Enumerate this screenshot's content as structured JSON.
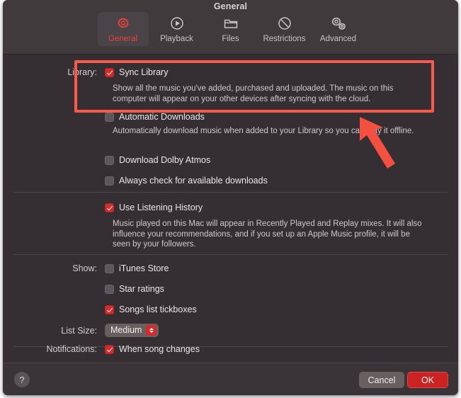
{
  "window": {
    "title": "General"
  },
  "toolbar": {
    "tabs": [
      {
        "label": "General",
        "icon": "gear-icon",
        "selected": true
      },
      {
        "label": "Playback",
        "icon": "play-circle-icon",
        "selected": false
      },
      {
        "label": "Files",
        "icon": "folder-icon",
        "selected": false
      },
      {
        "label": "Restrictions",
        "icon": "prohibit-icon",
        "selected": false
      },
      {
        "label": "Advanced",
        "icon": "dual-gear-icon",
        "selected": false
      }
    ]
  },
  "library": {
    "field_label": "Library:",
    "sync_library": {
      "label": "Sync Library",
      "checked": true,
      "description": "Show all the music you've added, purchased and uploaded. The music on this computer will appear on your other devices after syncing with the cloud."
    },
    "automatic_downloads": {
      "label": "Automatic Downloads",
      "checked": false,
      "description": "Automatically download music when added to your Library so you can play it offline."
    },
    "download_dolby_atmos": {
      "label": "Download Dolby Atmos",
      "checked": false
    },
    "always_check": {
      "label": "Always check for available downloads",
      "checked": false
    }
  },
  "listening_history": {
    "label": "Use Listening History",
    "checked": true,
    "description": "Music played on this Mac will appear in Recently Played and Replay mixes. It will also influence your recommendations, and if you set up an Apple Music profile, it will be seen by your followers."
  },
  "show": {
    "field_label": "Show:",
    "items": [
      {
        "label": "iTunes Store",
        "checked": false
      },
      {
        "label": "Star ratings",
        "checked": false
      },
      {
        "label": "Songs list tickboxes",
        "checked": true
      }
    ]
  },
  "list_size": {
    "field_label": "List Size:",
    "value": "Medium"
  },
  "notifications": {
    "field_label": "Notifications:",
    "item": {
      "label": "When song changes",
      "checked": true
    }
  },
  "footer": {
    "help_label": "?",
    "cancel_label": "Cancel",
    "ok_label": "OK"
  },
  "annotations": {
    "highlight_color": "#fa5a4b",
    "arrow_color": "#f4503f"
  }
}
